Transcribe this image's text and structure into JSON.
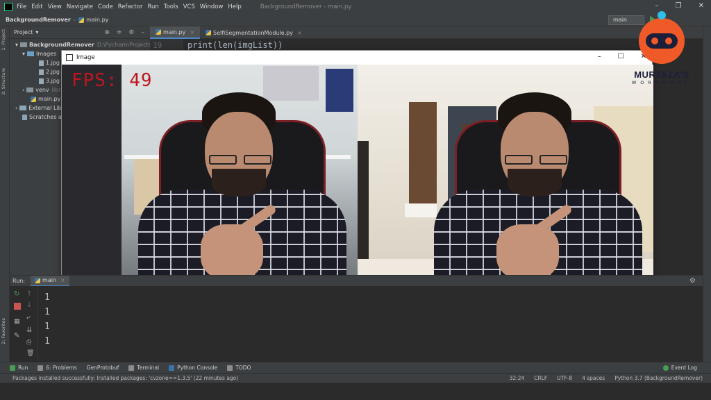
{
  "menubar": {
    "items": [
      "File",
      "Edit",
      "View",
      "Navigate",
      "Code",
      "Refactor",
      "Run",
      "Tools",
      "VCS",
      "Window",
      "Help"
    ],
    "window_title": "BackgroundRemover - main.py"
  },
  "navbar": {
    "project": "BackgroundRemover",
    "file": "main.py",
    "run_config": "main"
  },
  "left_tabs": {
    "project": "1: Project",
    "structure": "2: Structure",
    "favorites": "2: Favorites"
  },
  "project_panel": {
    "title": "Project",
    "tree": [
      {
        "label": "BackgroundRemover",
        "extra": "D:\\PycharmProjects\\Backg",
        "kind": "folder"
      },
      {
        "label": "Images",
        "kind": "folder-blue"
      },
      {
        "label": "1.jpg",
        "kind": "jpg"
      },
      {
        "label": "2.jpg",
        "kind": "jpg"
      },
      {
        "label": "3.jpg",
        "kind": "jpg"
      },
      {
        "label": "venv",
        "extra": "libra",
        "kind": "folder"
      },
      {
        "label": "main.py",
        "kind": "py"
      },
      {
        "label": "External Librar",
        "kind": "lib"
      },
      {
        "label": "Scratches and",
        "kind": "scratch"
      }
    ]
  },
  "editor": {
    "tabs": [
      "main.py",
      "SelfiSegmentationModule.py"
    ],
    "line_number": "19",
    "code_line": "print(len(imgList))"
  },
  "image_window": {
    "title": "Image",
    "fps_text": "FPS: 49"
  },
  "brand": {
    "name": "MURTAZA'S",
    "sub": "WORKSHOP"
  },
  "run_panel": {
    "label": "Run:",
    "tab": "main",
    "output": [
      "1",
      "1",
      "1",
      "1"
    ]
  },
  "tool_tabs": [
    {
      "label": "Run"
    },
    {
      "label": "6: Problems"
    },
    {
      "label": "GenProtobuf"
    },
    {
      "label": "Terminal"
    },
    {
      "label": "Python Console"
    },
    {
      "label": "TODO"
    }
  ],
  "event_log": "Event Log",
  "statusbar": {
    "message": "Packages installed successfully: Installed packages: 'cvzone==1.3.5' (22 minutes ago)",
    "position": "32:24",
    "line_sep": "CRLF",
    "encoding": "UTF-8",
    "indent": "4 spaces",
    "interpreter": "Python 3.7 (BackgroundRemover)"
  },
  "colors": {
    "fps_red": "#c0161f",
    "accent_blue": "#4a88c7",
    "run_green": "#499c54",
    "brand_orange": "#f05a28"
  }
}
